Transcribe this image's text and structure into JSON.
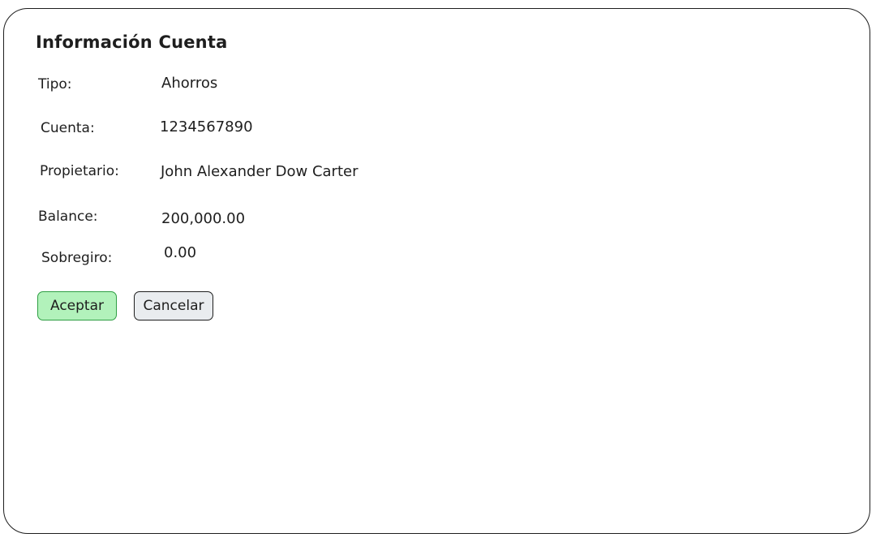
{
  "title": "Información Cuenta",
  "fields": {
    "tipo": {
      "label": "Tipo:",
      "value": "Ahorros"
    },
    "cuenta": {
      "label": "Cuenta:",
      "value": "1234567890"
    },
    "propietario": {
      "label": "Propietario:",
      "value": "John Alexander Dow Carter"
    },
    "balance": {
      "label": "Balance:",
      "value": "200,000.00"
    },
    "sobregiro": {
      "label": "Sobregiro:",
      "value": "0.00"
    }
  },
  "buttons": {
    "accept_label": "Aceptar",
    "cancel_label": "Cancelar"
  },
  "colors": {
    "accept_bg": "#b2f2bb",
    "accept_border": "#2f9e44",
    "cancel_bg": "#e9ecef",
    "stroke": "#1e1e1e"
  }
}
